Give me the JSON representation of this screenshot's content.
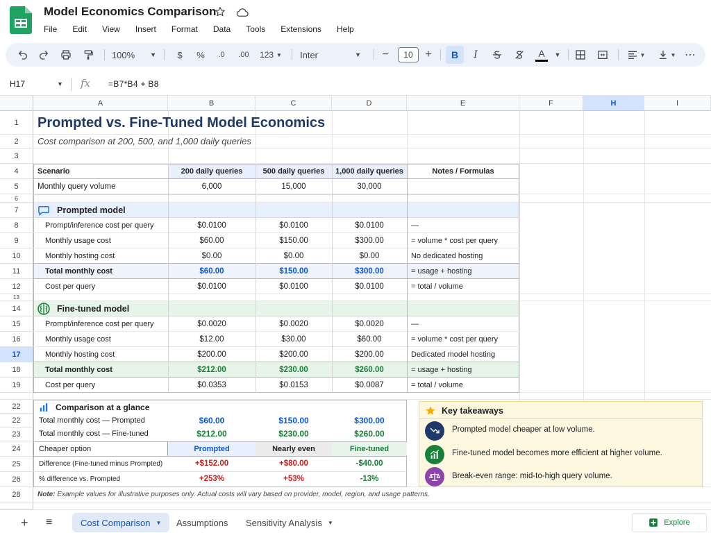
{
  "app": {
    "title": "Model Economics Comparison",
    "menus": [
      "File",
      "Edit",
      "View",
      "Insert",
      "Format",
      "Data",
      "Tools",
      "Extensions",
      "Help"
    ]
  },
  "toolbar": {
    "zoom": "100%",
    "currency": "$",
    "percent": "%",
    "decrease_decimal": ".0",
    "increase_decimal": ".00",
    "number_format": "123",
    "font": "Inter",
    "font_size": "10",
    "minus": "−",
    "plus": "+",
    "bold": "B",
    "italic": "I",
    "text_color_glyph": "A",
    "more": "⋯"
  },
  "formula_bar": {
    "name_box": "H17",
    "fx": "fx",
    "formula": "=B7*B4 + B8"
  },
  "columns": [
    "A",
    "B",
    "C",
    "D",
    "E",
    "F",
    "H",
    "I"
  ],
  "rows": [
    "1",
    "2",
    "3",
    "4",
    "5",
    "6",
    "7",
    "8",
    "9",
    "10",
    "11",
    "12",
    "13",
    "14",
    "15",
    "16",
    "17",
    "18",
    "19",
    "22",
    "22",
    "23",
    "24",
    "25",
    "26",
    "28"
  ],
  "sheet": {
    "title": "Prompted vs. Fine-Tuned Model Economics",
    "subtitle": "Cost comparison at 200, 500, and 1,000 daily queries",
    "header": [
      "Scenario",
      "200 daily queries",
      "500 daily queries",
      "1,000 daily queries",
      "Notes / Formulas"
    ],
    "volume": {
      "label": "Monthly query volume",
      "values": [
        "6,000",
        "15,000",
        "30,000"
      ]
    },
    "prompted": {
      "section": "Prompted model",
      "rows": [
        {
          "label": "Prompt/inference cost per query",
          "values": [
            "$0.0100",
            "$0.0100",
            "$0.0100"
          ],
          "note": "—"
        },
        {
          "label": "Monthly usage cost",
          "values": [
            "$60.00",
            "$150.00",
            "$300.00"
          ],
          "note": "= volume * cost per query"
        },
        {
          "label": "Monthly hosting cost",
          "values": [
            "$0.00",
            "$0.00",
            "$0.00"
          ],
          "note": "No dedicated hosting"
        },
        {
          "label": "Total monthly cost",
          "values": [
            "$60.00",
            "$150.00",
            "$300.00"
          ],
          "note": "= usage + hosting"
        },
        {
          "label": "Cost per query",
          "values": [
            "$0.0100",
            "$0.0100",
            "$0.0100"
          ],
          "note": "= total / volume"
        }
      ]
    },
    "finetuned": {
      "section": "Fine-tuned model",
      "rows": [
        {
          "label": "Prompt/inference cost per query",
          "values": [
            "$0.0020",
            "$0.0020",
            "$0.0020"
          ],
          "note": "—"
        },
        {
          "label": "Monthly usage cost",
          "values": [
            "$12.00",
            "$30.00",
            "$60.00"
          ],
          "note": "= volume * cost per query"
        },
        {
          "label": "Monthly hosting cost",
          "values": [
            "$200.00",
            "$200.00",
            "$200.00"
          ],
          "note": "Dedicated model hosting"
        },
        {
          "label": "Total monthly cost",
          "values": [
            "$212.00",
            "$230.00",
            "$260.00"
          ],
          "note": "= usage + hosting"
        },
        {
          "label": "Cost per query",
          "values": [
            "$0.0353",
            "$0.0153",
            "$0.0087"
          ],
          "note": "= total / volume"
        }
      ]
    },
    "glance": {
      "title": "Comparison at a glance",
      "total_prompted": {
        "label": "Total monthly cost — Prompted",
        "values": [
          "$60.00",
          "$150.00",
          "$300.00"
        ]
      },
      "total_finetuned": {
        "label": "Total monthly cost — Fine-tuned",
        "values": [
          "$212.00",
          "$230.00",
          "$260.00"
        ]
      },
      "cheaper": {
        "label": "Cheaper option",
        "values": [
          "Prompted",
          "Nearly even",
          "Fine-tuned"
        ]
      },
      "difference": {
        "label": "Difference (Fine-tuned minus Prompted)",
        "values": [
          "+$152.00",
          "+$80.00",
          "-$40.00"
        ]
      },
      "pct": {
        "label": "% difference vs. Prompted",
        "values": [
          "+253%",
          "+53%",
          "-13%"
        ]
      }
    },
    "note_label": "Note:",
    "note_text": "Example values for illustrative purposes only. Actual costs will vary based on provider, model, region, and usage patterns."
  },
  "takeaways": {
    "title": "Key takeaways",
    "items": [
      "Prompted model cheaper at low volume.",
      "Fine-tuned model becomes more efficient at higher volume.",
      "Break-even range: mid-to-high query volume."
    ]
  },
  "tabs": {
    "add": "+",
    "list": "≡",
    "items": [
      "Cost Comparison",
      "Assumptions",
      "Sensitivity Analysis"
    ],
    "explore": "Explore"
  },
  "colors": {
    "accent_blue": "#0b57d0",
    "green": "#188038",
    "red": "#c5221f",
    "prompted_band": "#e8f0fe",
    "finetuned_band": "#e6f4ea",
    "takeaway_bg": "#fef7e0"
  }
}
